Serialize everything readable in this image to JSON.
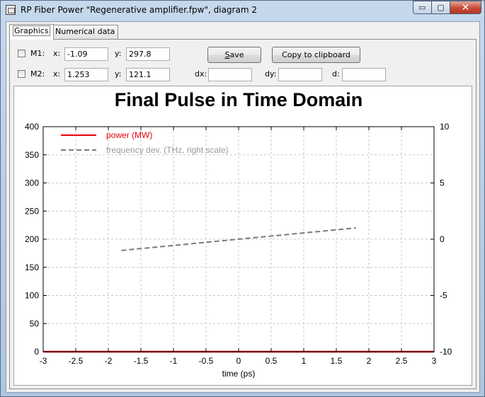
{
  "window": {
    "title": "RP Fiber Power \"Regenerative amplifier.fpw\", diagram 2",
    "min_label": "▭",
    "max_label": "▢",
    "close_label": "✕"
  },
  "tabs": [
    {
      "label": "Graphics",
      "active": true
    },
    {
      "label": "Numerical data",
      "active": false
    }
  ],
  "markers": {
    "m1": {
      "label": "M1:",
      "x_label": "x:",
      "x": "-1.09",
      "y_label": "y:",
      "y": "297.8"
    },
    "m2": {
      "label": "M2:",
      "x_label": "x:",
      "x": "1.253",
      "y_label": "y:",
      "y": "121.1"
    },
    "dx_label": "dx:",
    "dx": "",
    "dy_label": "dy:",
    "dy": "",
    "d_label": "d:",
    "d": ""
  },
  "buttons": {
    "save_label_underlined": "S",
    "save_label_rest": "ave",
    "copy_label": "Copy to clipboard"
  },
  "chart_data": {
    "type": "line",
    "title": "Final Pulse in Time Domain",
    "xlabel": "time (ps)",
    "ylabel": "",
    "xlim": [
      -3,
      3
    ],
    "ylim": [
      0,
      400
    ],
    "y2lim": [
      -10,
      10
    ],
    "x_ticks": [
      "-3",
      "-2.5",
      "-2",
      "-1.5",
      "-1",
      "-0.5",
      "0",
      "0.5",
      "1",
      "1.5",
      "2",
      "2.5",
      "3"
    ],
    "y_ticks": [
      "0",
      "50",
      "100",
      "150",
      "200",
      "250",
      "300",
      "350",
      "400"
    ],
    "y2_ticks": [
      "-10",
      "-5",
      "0",
      "5",
      "10"
    ],
    "grid": true,
    "legend_position": "top-left",
    "series": [
      {
        "name": "power (MW)",
        "axis": "left",
        "color": "#e8000b",
        "style": "solid",
        "x": [
          -3,
          3
        ],
        "y": [
          0,
          0
        ]
      },
      {
        "name": "frequency dev. (THz, right scale)",
        "axis": "right",
        "color": "#7a7a7a",
        "style": "dashed",
        "x": [
          -1.8,
          1.8
        ],
        "y": [
          -1.0,
          1.0
        ]
      }
    ]
  }
}
